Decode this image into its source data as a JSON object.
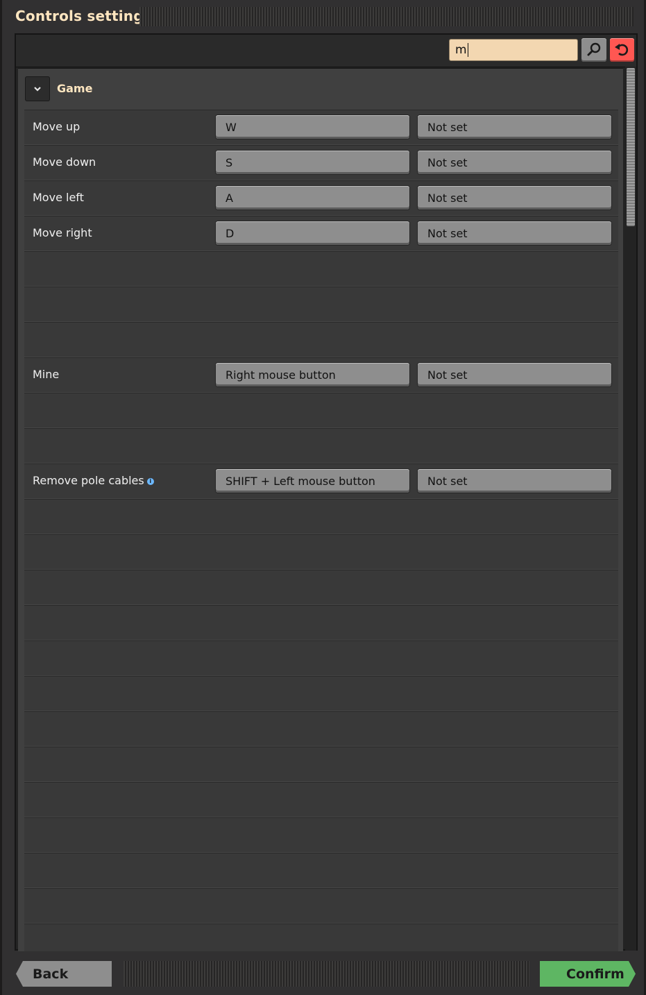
{
  "window": {
    "title": "Controls settings"
  },
  "search": {
    "value": "m",
    "search_icon": "magnifier-icon",
    "reset_icon": "reset-icon"
  },
  "section": {
    "title": "Game",
    "toggle_icon": "chevron-down-icon"
  },
  "rows": [
    {
      "name": "Move up",
      "primary": "W",
      "secondary": "Not set"
    },
    {
      "name": "Move down",
      "primary": "S",
      "secondary": "Not set"
    },
    {
      "name": "Move left",
      "primary": "A",
      "secondary": "Not set"
    },
    {
      "name": "Move right",
      "primary": "D",
      "secondary": "Not set"
    },
    {
      "empty": true
    },
    {
      "empty": true
    },
    {
      "empty": true
    },
    {
      "name": "Mine",
      "primary": "Right mouse button",
      "secondary": "Not set"
    },
    {
      "empty": true
    },
    {
      "empty": true
    },
    {
      "name": "Remove pole cables",
      "info": "i",
      "primary": "SHIFT + Left mouse button",
      "secondary": "Not set"
    },
    {
      "empty": true
    },
    {
      "empty": true
    },
    {
      "empty": true
    },
    {
      "empty": true
    },
    {
      "empty": true
    },
    {
      "empty": true
    },
    {
      "empty": true
    },
    {
      "empty": true
    },
    {
      "empty": true
    },
    {
      "empty": true
    },
    {
      "empty": true
    },
    {
      "empty": true
    },
    {
      "empty": true
    },
    {
      "empty": true
    }
  ],
  "footer": {
    "back_label": "Back",
    "confirm_label": "Confirm"
  },
  "colors": {
    "title": "#ffe6c0",
    "confirm": "#5eb663",
    "reset": "#ff5752",
    "search_bg": "#f3d7b1"
  }
}
